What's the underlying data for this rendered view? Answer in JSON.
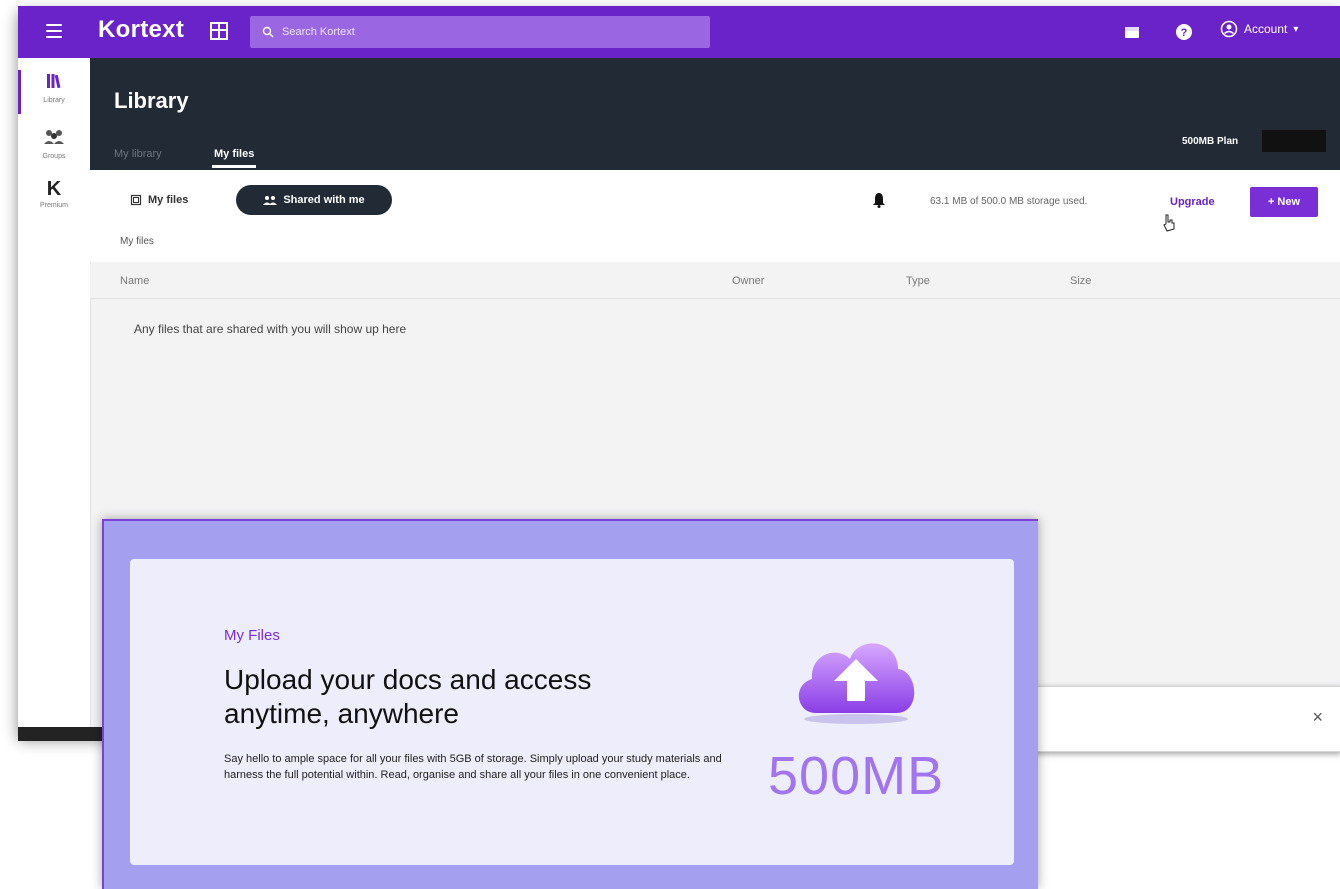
{
  "topbar": {
    "brand": "Kortext",
    "search_placeholder": "Search Kortext",
    "account_label": "Account"
  },
  "sidebar": {
    "items": [
      {
        "label": "Library",
        "icon": "library-icon"
      },
      {
        "label": "Groups",
        "icon": "groups-icon"
      },
      {
        "label": "Premium",
        "icon": "kortext-k-icon"
      }
    ]
  },
  "header": {
    "title": "Library",
    "tabs": [
      {
        "label": "My library",
        "active": false
      },
      {
        "label": "My files",
        "active": true
      }
    ],
    "plan": "500MB Plan"
  },
  "filebar": {
    "toggle": {
      "my_files": "My files",
      "shared": "Shared with me"
    },
    "breadcrumb": "My files",
    "storage": "63.1 MB of 500.0 MB storage used.",
    "upgrade": "Upgrade",
    "new_button": "+ New"
  },
  "table": {
    "columns": [
      "Name",
      "Owner",
      "Type",
      "Size"
    ],
    "empty_message": "Any files that are shared with you will show up here"
  },
  "snackbar": {
    "close": "×"
  },
  "promo": {
    "eyebrow": "My Files",
    "title": "Upload your docs and access anytime, anywhere",
    "body": "Say hello to ample space for all your files with 5GB of storage. Simply upload your study materials and harness the full potential within. Read, organise and share all your files in one convenient place.",
    "size": "500MB"
  },
  "colors": {
    "brand_purple": "#6a22c9",
    "header_dark": "#212a35",
    "promo_bg": "#a59ff0",
    "promo_card": "#eeedfb"
  }
}
